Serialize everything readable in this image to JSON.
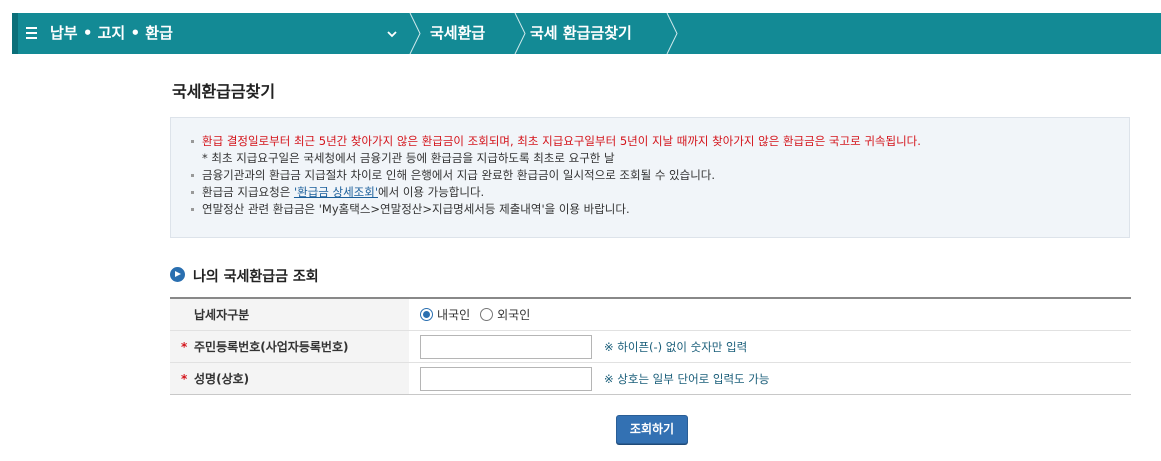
{
  "nav": {
    "main_label": "납부 • 고지 • 환급",
    "crumbs": [
      "국세환급",
      "국세 환급금찾기"
    ]
  },
  "page": {
    "title": "국세환급금찾기"
  },
  "info": {
    "line1": "환급 결정일로부터 최근 5년간 찾아가지 않은 환급금이 조회되며, 최초 지급요구일부터 5년이 지날 때까지 찾아가지 않은 환급금은 국고로 귀속됩니다.",
    "line1_note": "* 최초 지급요구일은 국세청에서 금융기관 등에 환급금을 지급하도록 최초로 요구한 날",
    "line2": "금융기관과의 환급금 지급절차 차이로 인해 은행에서 지급 완료한 환급금이 일시적으로 조회될 수 있습니다.",
    "line3_pre": "환급금 지급요청은 ",
    "line3_link": "'환급금 상세조회'",
    "line3_post": "에서 이용 가능합니다.",
    "line4": "연말정산 관련 환급금은 'My홈택스>연말정산>지급명세서등 제출내역'을 이용 바랍니다."
  },
  "section": {
    "title": "나의 국세환급금 조회"
  },
  "form": {
    "taxpayer_type_label": "납세자구분",
    "radio_domestic": "내국인",
    "radio_foreign": "외국인",
    "id_label": "주민등록번호(사업자등록번호)",
    "id_value": "",
    "id_hint": "※ 하이픈(-) 없이 숫자만 입력",
    "name_label": "성명(상호)",
    "name_value": "",
    "name_hint": "※ 상호는 일부 단어로 입력도 가능",
    "required_mark": "*"
  },
  "buttons": {
    "search": "조회하기"
  },
  "colors": {
    "nav_bg": "#138a95",
    "notice_red": "#d4141b",
    "button_blue": "#3371b3"
  }
}
